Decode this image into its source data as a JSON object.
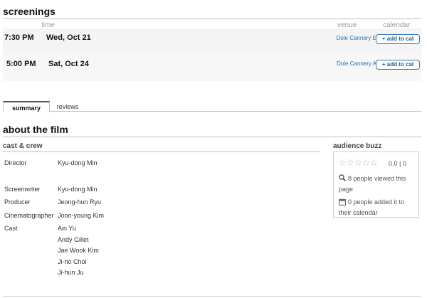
{
  "screenings": {
    "title": "screenings",
    "columns": {
      "time": "time",
      "venue": "venue",
      "calendar": "calendar"
    },
    "rows": [
      {
        "time": "7:30 PM",
        "date": "Wed, Oct 21",
        "venue": "Dole Cannery E",
        "button": "+ add to cal"
      },
      {
        "time": "5:00 PM",
        "date": "Sat, Oct 24",
        "venue": "Dole Cannery A",
        "button": "+ add to cal"
      }
    ]
  },
  "tabs": [
    {
      "label": "summary",
      "active": true
    },
    {
      "label": "reviews",
      "active": false
    }
  ],
  "about": {
    "title": "about the film",
    "cast_crew_heading": "cast & crew",
    "credits": [
      {
        "label": "Director",
        "values": [
          "Kyu-dong Min"
        ]
      },
      {
        "label": "Screenwriter",
        "values": [
          "Kyu-dong Min"
        ]
      },
      {
        "label": "Producer",
        "values": [
          "Jeong-hun Ryu"
        ]
      },
      {
        "label": "Cinematographer",
        "values": [
          "Joon-young Kim"
        ]
      },
      {
        "label": "Cast",
        "values": [
          "Ain Yu",
          "Andy Gillet",
          "Jae Wook Kim",
          "Ji-ho Choi",
          "Ji-hun Ju"
        ]
      }
    ]
  },
  "buzz": {
    "heading": "audience buzz",
    "stars_total": 5,
    "stars_filled": 0,
    "rating_text": "0.0 | 0",
    "views_text": "8 people viewed this page",
    "calendar_text": "0 people added it to their calendar",
    "icons": {
      "views": "magnifier-icon",
      "calendar": "calendar-icon"
    }
  },
  "colors": {
    "link": "#2a6fa8",
    "button_border": "#3b7ab8",
    "row_bg": "#f4f4f4"
  }
}
